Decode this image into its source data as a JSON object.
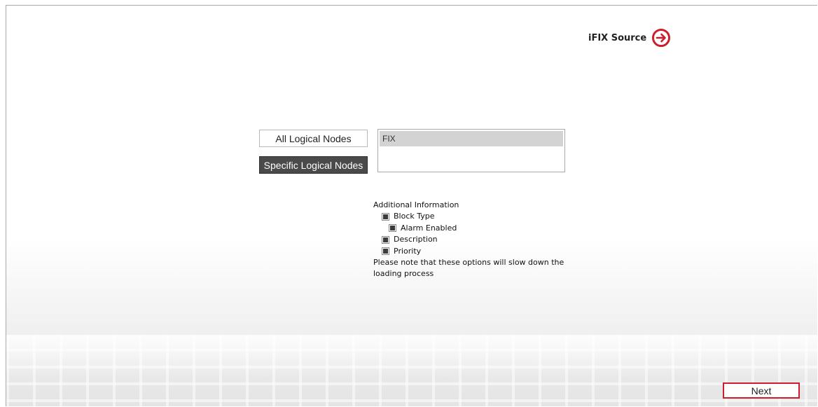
{
  "header": {
    "source_label": "iFIX Source",
    "source_icon": "arrow-right-circle-icon",
    "accent_color": "#cc1f2d"
  },
  "node_selection": {
    "all_label": "All Logical Nodes",
    "specific_label": "Specific Logical Nodes",
    "selected_mode": "Specific Logical Nodes",
    "nodes": [
      "FIX"
    ]
  },
  "additional_info": {
    "heading": "Additional Information",
    "options": [
      {
        "label": "Block Type",
        "checked": true
      },
      {
        "label": "Alarm Enabled",
        "checked": true
      },
      {
        "label": "Description",
        "checked": true
      },
      {
        "label": "Priority",
        "checked": true
      }
    ],
    "note": "Please note that these options will slow down the loading process"
  },
  "footer": {
    "next_label": "Next"
  }
}
